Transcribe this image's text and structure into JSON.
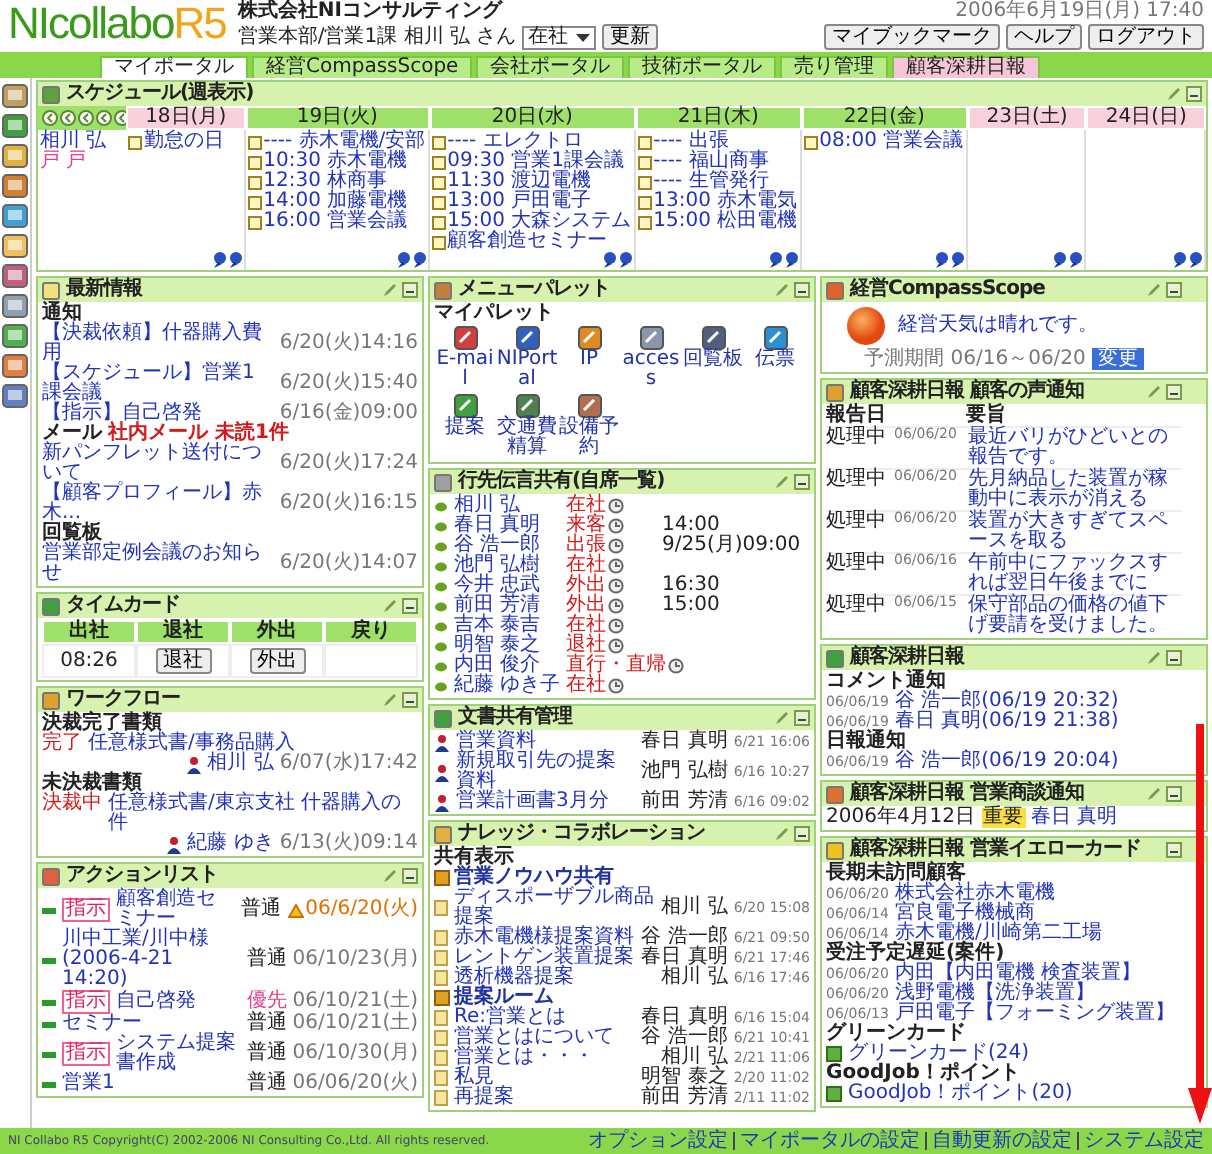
{
  "header": {
    "logo": "NIcollabo",
    "logo_version": "R5",
    "company": "株式会社NIコンサルティング",
    "user": "営業本部/営業1課 相川 弘 さん",
    "status_select": "在社",
    "update_button": "更新",
    "datetime": "2006年6月19日(月) 17:40",
    "buttons": [
      "マイブックマーク",
      "ヘルプ",
      "ログアウト"
    ]
  },
  "tabs": [
    {
      "label": "マイポータル",
      "selected": true,
      "kind": "normal"
    },
    {
      "label": "経営CompassScope",
      "selected": false,
      "kind": "normal"
    },
    {
      "label": "会社ポータル",
      "selected": false,
      "kind": "normal"
    },
    {
      "label": "技術ポータル",
      "selected": false,
      "kind": "normal"
    },
    {
      "label": "売り管理",
      "selected": false,
      "kind": "normal"
    },
    {
      "label": "顧客深耕日報",
      "selected": false,
      "kind": "special"
    }
  ],
  "schedule": {
    "title": "スケジュール(週表示)",
    "member": {
      "name": "相川 弘",
      "note": "戸 戸"
    },
    "days": [
      {
        "label": "18日(月)",
        "kind": "today",
        "events": [
          "勤怠の日"
        ]
      },
      {
        "label": "19日(火)",
        "kind": "weekday",
        "events": [
          "---- 赤木電機/安部",
          "10:30 赤木電機",
          "12:30 林商事",
          "14:00 加藤電機",
          "16:00 営業会議"
        ]
      },
      {
        "label": "20日(水)",
        "kind": "weekday",
        "events": [
          "---- エレクトロ",
          "09:30 営業1課会議",
          "11:30 渡辺電機",
          "13:00 戸田電子",
          "15:00 大森システム",
          "顧客創造セミナー"
        ]
      },
      {
        "label": "21日(木)",
        "kind": "weekday",
        "events": [
          "---- 出張",
          "---- 福山商事",
          "---- 生管発行",
          "13:00 赤木電気",
          "15:00 松田電機"
        ]
      },
      {
        "label": "22日(金)",
        "kind": "weekday",
        "events": [
          "08:00 営業会議"
        ]
      },
      {
        "label": "23日(土)",
        "kind": "weekend"
      },
      {
        "label": "24日(日)",
        "kind": "weekend"
      }
    ]
  },
  "news": {
    "title": "最新情報",
    "sections": [
      {
        "heading": "通知",
        "items": [
          {
            "text": "【決裁依頼】什器購入費用",
            "time": "6/20(火)14:16"
          },
          {
            "text": "【スケジュール】営業1課会議",
            "time": "6/20(火)15:40"
          },
          {
            "text": "【指示】自己啓発",
            "time": "6/16(金)09:00"
          }
        ]
      },
      {
        "heading": "メール",
        "note": "社内メール 未読1件",
        "items": [
          {
            "text": "新パンフレット送付について",
            "time": "6/20(火)17:24"
          },
          {
            "text": "【顧客プロフィール】赤木...",
            "time": "6/20(火)16:15"
          }
        ]
      },
      {
        "heading": "回覧板",
        "items": [
          {
            "text": "営業部定例会議のお知らせ",
            "time": "6/20(火)14:07"
          }
        ]
      }
    ]
  },
  "timecard": {
    "title": "タイムカード",
    "columns": [
      "出社",
      "退社",
      "外出",
      "戻り"
    ],
    "clock_in": "08:26",
    "buttons": [
      "退社",
      "外出"
    ]
  },
  "workflow": {
    "title": "ワークフロー",
    "sections": [
      {
        "heading": "決裁完了書類",
        "items": [
          {
            "status": "完了",
            "text": "任意様式書/事務品購入",
            "person": "相川 弘",
            "time": "6/07(水)17:42"
          }
        ]
      },
      {
        "heading": "未決裁書類",
        "items": [
          {
            "status": "決裁中",
            "text": "任意様式書/東京支社 什器購入の件",
            "person": "紀藤 ゆき",
            "time": "6/13(火)09:14"
          }
        ]
      }
    ]
  },
  "action_list": {
    "title": "アクションリスト",
    "items": [
      {
        "tag": "指示",
        "text": "顧客創造セミナー",
        "priority": "普通",
        "priority_high": false,
        "due": "06/6/20(火)",
        "overdue": true
      },
      {
        "text": "川中工業/川中様(2006-4-21 14:20)",
        "priority": "普通",
        "priority_high": false,
        "due": "06/10/23(月)",
        "overdue": false
      },
      {
        "tag": "指示",
        "text": "自己啓発",
        "priority": "優先",
        "priority_high": true,
        "due": "06/10/21(土)",
        "overdue": false
      },
      {
        "text": "セミナー",
        "priority": "普通",
        "priority_high": false,
        "due": "06/10/21(土)",
        "overdue": false
      },
      {
        "tag": "指示",
        "text": "システム提案書作成",
        "priority": "普通",
        "priority_high": false,
        "due": "06/10/30(月)",
        "overdue": false
      },
      {
        "text": "営業1",
        "priority": "普通",
        "priority_high": false,
        "due": "06/06/20(火)",
        "overdue": false
      }
    ]
  },
  "menu_palette": {
    "title": "メニューパレット",
    "subtitle": "マイパレット",
    "items": [
      "E-mail",
      "NIPortal",
      "IP",
      "access",
      "回覧板",
      "伝票",
      "提案",
      "交通費精算",
      "設備予約"
    ]
  },
  "whereabouts": {
    "title": "行先伝言共有(自席一覧)",
    "rows": [
      {
        "name": "相川 弘",
        "status": "在社"
      },
      {
        "name": "春日 真明",
        "status": "来客",
        "time": "14:00"
      },
      {
        "name": "谷 浩一郎",
        "status": "出張",
        "time": "9/25(月)09:00"
      },
      {
        "name": "池門 弘樹",
        "status": "在社"
      },
      {
        "name": "今井 忠武",
        "status": "外出",
        "time": "16:30"
      },
      {
        "name": "前田 芳清",
        "status": "外出",
        "time": "15:00"
      },
      {
        "name": "吉本 泰吉",
        "status": "在社"
      },
      {
        "name": "明智 泰之",
        "status": "退社"
      },
      {
        "name": "内田 俊介",
        "status": "直行・直帰"
      },
      {
        "name": "紀藤 ゆき子",
        "status": "在社"
      }
    ]
  },
  "documents": {
    "title": "文書共有管理",
    "rows": [
      {
        "title": "営業資料",
        "author": "春日 真明",
        "date": "6/21 16:06"
      },
      {
        "title": "新規取引先の提案資料",
        "author": "池門 弘樹",
        "date": "6/16 10:27"
      },
      {
        "title": "営業計画書3月分",
        "author": "前田 芳清",
        "date": "6/16 09:02"
      }
    ]
  },
  "knowledge": {
    "title": "ナレッジ・コラボレーション",
    "scope": "共有表示",
    "groups": [
      {
        "title": "営業ノウハウ共有",
        "items": [
          {
            "text": "ディスポーザブル商品提案",
            "author": "相川 弘",
            "date": "6/20 15:08"
          },
          {
            "text": "赤木電機様提案資料",
            "author": "谷 浩一郎",
            "date": "6/21 09:50"
          },
          {
            "text": "レントゲン装置提案",
            "author": "春日 真明",
            "date": "6/21 17:46"
          },
          {
            "text": "透析機器提案",
            "author": "相川 弘",
            "date": "6/16 17:46"
          }
        ]
      },
      {
        "title": "提案ルーム",
        "items": [
          {
            "text": "Re:営業とは",
            "author": "春日 真明",
            "date": "6/16 15:04"
          },
          {
            "text": "営業とはについて",
            "author": "谷 浩一郎",
            "date": "6/21 10:41"
          },
          {
            "text": "営業とは・・・",
            "author": "相川 弘",
            "date": "2/21 11:06"
          },
          {
            "text": "私見",
            "author": "明智 泰之",
            "date": "2/20 11:02"
          },
          {
            "text": "再提案",
            "author": "前田 芳清",
            "date": "2/11 11:02"
          }
        ]
      }
    ]
  },
  "compass": {
    "title": "経営CompassScope",
    "message": "経営天気は晴れです。",
    "period": "予測期間 06/16～06/20",
    "button": "変更"
  },
  "customer_voice": {
    "title": "顧客深耕日報 顧客の声通知",
    "columns": [
      "報告日",
      "要旨"
    ],
    "rows": [
      {
        "status": "処理中",
        "date": "06/06/20",
        "text": "最近バリがひどいとの報告です。"
      },
      {
        "status": "処理中",
        "date": "06/06/20",
        "text": "先月納品した装置が稼動中に表示が消える"
      },
      {
        "status": "処理中",
        "date": "06/06/20",
        "text": "装置が大きすぎてスペースを取る"
      },
      {
        "status": "処理中",
        "date": "06/06/16",
        "text": "午前中にファックスすれば翌日午後までに"
      },
      {
        "status": "処理中",
        "date": "06/06/15",
        "text": "保守部品の価格の値下げ要請を受けました。"
      }
    ]
  },
  "daily_report": {
    "title": "顧客深耕日報",
    "sections": [
      {
        "heading": "コメント通知",
        "items": [
          {
            "date": "06/06/19",
            "text": "谷 浩一郎(06/19 20:32)"
          },
          {
            "date": "06/06/19",
            "text": "春日 真明(06/19 21:38)"
          }
        ]
      },
      {
        "heading": "日報通知",
        "items": [
          {
            "date": "06/06/19",
            "text": "谷 浩一郎(06/19 20:04)"
          }
        ]
      }
    ]
  },
  "deal_notice": {
    "title": "顧客深耕日報 営業商談通知",
    "rows": [
      {
        "date": "2006年4月12日",
        "tag": "重要",
        "text": "春日 真明"
      }
    ]
  },
  "yellow_card": {
    "title": "顧客深耕日報 営業イエローカード",
    "sections": [
      {
        "heading": "長期未訪問顧客",
        "items": [
          {
            "date": "06/06/20",
            "text": "株式会社赤木電機"
          },
          {
            "date": "06/06/14",
            "text": "宮良電子機械商"
          },
          {
            "date": "06/06/14",
            "text": "赤木電機/川崎第二工場"
          }
        ]
      },
      {
        "heading": "受注予定遅延(案件)",
        "items": [
          {
            "date": "06/06/20",
            "text": "内田【内田電機 検査装置】"
          },
          {
            "date": "06/06/20",
            "text": "浅野電機【洗浄装置】"
          },
          {
            "date": "06/06/13",
            "text": "戸田電子【フォーミング装置】"
          }
        ]
      },
      {
        "heading": "グリーンカード",
        "items": [
          {
            "text": "グリーンカード(24)"
          }
        ]
      },
      {
        "heading": "GoodJob！ポイント",
        "items": [
          {
            "text": "GoodJob！ポイント(20)"
          }
        ]
      }
    ]
  },
  "footer": {
    "copyright": "NI Collabo R5 Copyright(C) 2002-2006 NI Consulting Co.,Ltd. All rights reserved.",
    "links": [
      "オプション設定",
      "マイポータルの設定",
      "自動更新の設定",
      "システム設定"
    ]
  }
}
